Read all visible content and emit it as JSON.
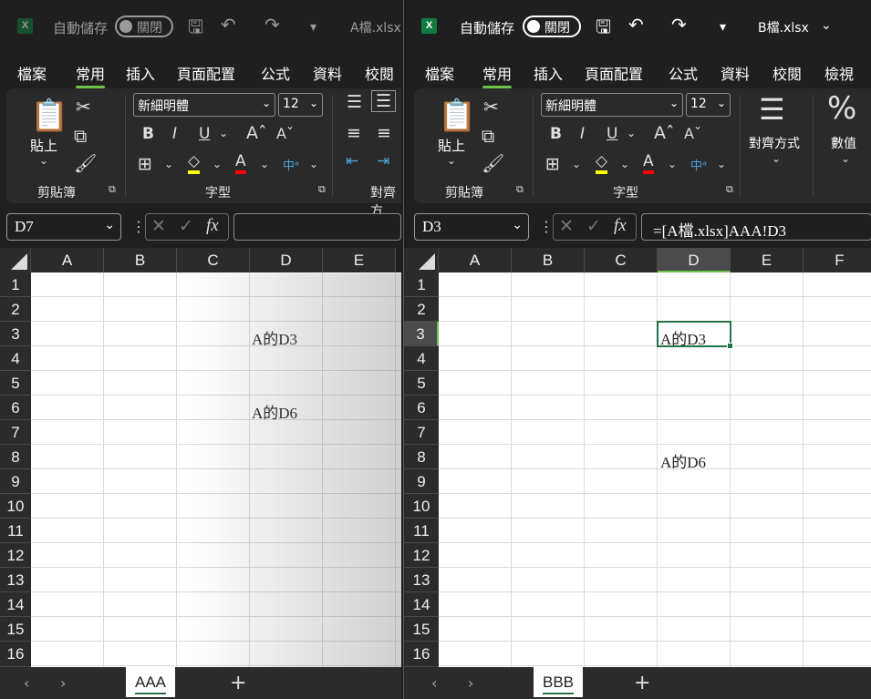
{
  "window_a": {
    "autosave_label": "自動儲存",
    "autosave_state": "關閉",
    "file_name": "A檔.xlsx",
    "menu": [
      "檔案",
      "常用",
      "插入",
      "頁面配置",
      "公式",
      "資料",
      "校閱"
    ],
    "ribbon": {
      "font_name": "新細明體",
      "font_size": "12",
      "clipboard_label": "剪貼簿",
      "paste_label": "貼上",
      "font_group_label": "字型",
      "align_group_label": "對齊方"
    },
    "name_box": "D7",
    "formula": "",
    "columns": [
      "A",
      "B",
      "C",
      "D",
      "E"
    ],
    "rows": [
      "1",
      "2",
      "3",
      "4",
      "5",
      "6",
      "7",
      "8",
      "9",
      "10",
      "11",
      "12",
      "13",
      "14",
      "15",
      "16"
    ],
    "cells": {
      "D3": "A的D3",
      "D6": "A的D6"
    },
    "sheet_tab": "AAA"
  },
  "window_b": {
    "autosave_label": "自動儲存",
    "autosave_state": "關閉",
    "file_name": "B檔.xlsx",
    "menu": [
      "檔案",
      "常用",
      "插入",
      "頁面配置",
      "公式",
      "資料",
      "校閱",
      "檢視"
    ],
    "ribbon": {
      "font_name": "新細明體",
      "font_size": "12",
      "clipboard_label": "剪貼簿",
      "paste_label": "貼上",
      "font_group_label": "字型",
      "align_label": "對齊方式",
      "number_label": "數值"
    },
    "name_box": "D3",
    "formula": "=[A檔.xlsx]AAA!D3",
    "columns": [
      "A",
      "B",
      "C",
      "D",
      "E",
      "F"
    ],
    "rows": [
      "1",
      "2",
      "3",
      "4",
      "5",
      "6",
      "7",
      "8",
      "9",
      "10",
      "11",
      "12",
      "13",
      "14",
      "15",
      "16"
    ],
    "cells": {
      "D3": "A的D3",
      "D8": "A的D6"
    },
    "sheet_tab": "BBB"
  },
  "icons": [
    "excel-logo",
    "save-icon",
    "undo-icon",
    "redo-icon",
    "customize-qat-icon",
    "paste-icon",
    "cut-icon",
    "copy-icon",
    "format-painter-icon",
    "bold-icon",
    "italic-icon",
    "underline-icon",
    "grow-font-icon",
    "shrink-font-icon",
    "borders-icon",
    "fill-color-icon",
    "font-color-icon",
    "phonetic-icon",
    "align-icon",
    "percent-icon",
    "cancel-icon",
    "enter-icon",
    "function-icon"
  ],
  "colors": {
    "accent_green": "#6cc24a",
    "excel_green": "#217346",
    "fill_yellow": "#ffff00",
    "font_red": "#ff0000"
  }
}
